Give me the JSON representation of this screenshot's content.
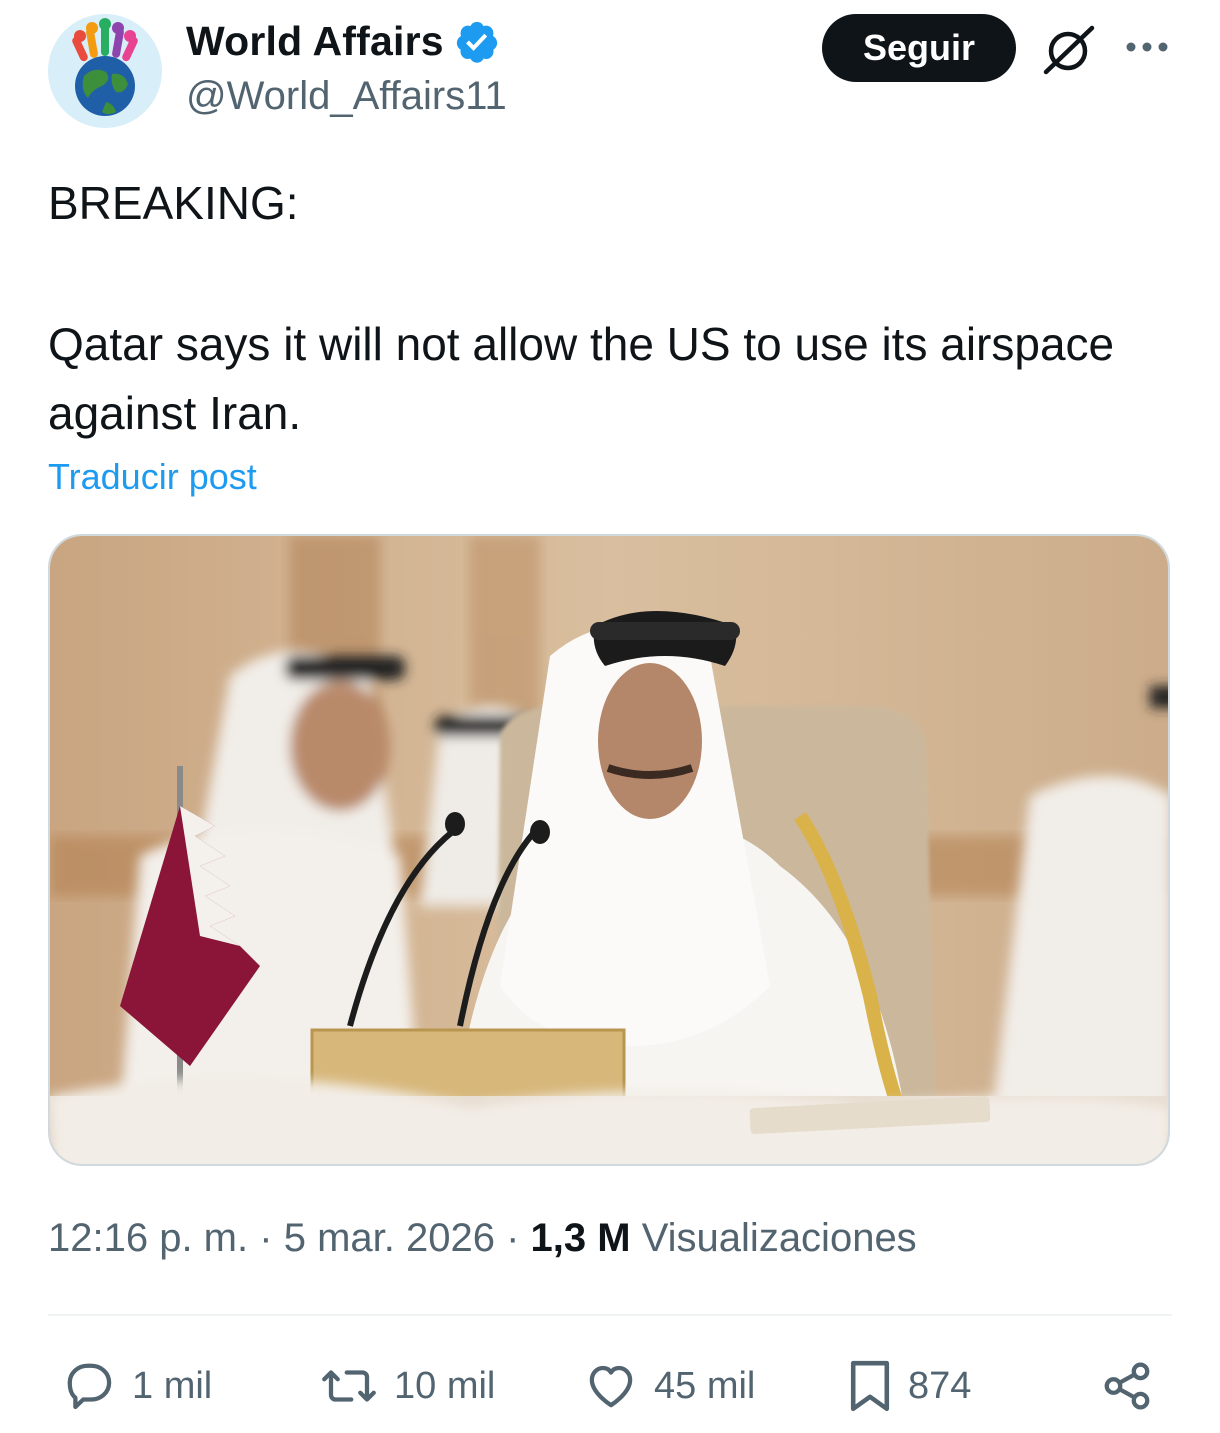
{
  "account": {
    "display_name": "World Affairs",
    "handle": "@World_Affairs11",
    "verified_color": "#1d9bf0"
  },
  "header": {
    "follow_label": "Seguir",
    "icons": [
      "grok-icon",
      "more-options-icon"
    ]
  },
  "post": {
    "headline": "BREAKING:",
    "body": "Qatar says it will not allow the US to use its airspace against Iran.",
    "translate_label": "Traducir post"
  },
  "meta": {
    "time": "12:16 p. m.",
    "separator": "·",
    "date": "5 mar. 2026",
    "views_count": "1,3 M",
    "views_label": "Visualizaciones"
  },
  "actions": {
    "replies": "1 mil",
    "reposts": "10 mil",
    "likes": "45 mil",
    "bookmarks": "874"
  },
  "colors": {
    "text": "#0f1419",
    "secondary": "#536471",
    "accent": "#1d9bf0",
    "follow_bg": "#0f1419"
  }
}
